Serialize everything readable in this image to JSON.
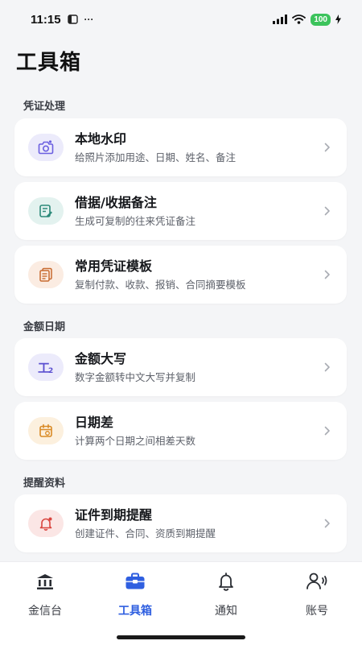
{
  "status_bar": {
    "time": "11:15",
    "extra": "···",
    "battery": "100"
  },
  "page_title": "工具箱",
  "sections": [
    {
      "title": "凭证处理",
      "items": [
        {
          "title": "本地水印",
          "subtitle": "给照片添加用途、日期、姓名、备注",
          "icon": "camera-icon",
          "icon_color": "#6b5fe0",
          "icon_bg": "#ecebfb"
        },
        {
          "title": "借据/收据备注",
          "subtitle": "生成可复制的往来凭证备注",
          "icon": "note-edit-icon",
          "icon_color": "#2d8a7a",
          "icon_bg": "#e3f2ef"
        },
        {
          "title": "常用凭证模板",
          "subtitle": "复制付款、收款、报销、合同摘要模板",
          "icon": "document-stack-icon",
          "icon_color": "#c86a2f",
          "icon_bg": "#fbece2"
        }
      ]
    },
    {
      "title": "金额日期",
      "items": [
        {
          "title": "金额大写",
          "subtitle": "数字金额转中文大写并复制",
          "icon": "amount-uppercase-icon",
          "icon_color": "#5a4fd0",
          "icon_bg": "#ecebfb"
        },
        {
          "title": "日期差",
          "subtitle": "计算两个日期之间相差天数",
          "icon": "calendar-icon",
          "icon_color": "#d98a25",
          "icon_bg": "#fcf0de"
        }
      ]
    },
    {
      "title": "提醒资料",
      "items": [
        {
          "title": "证件到期提醒",
          "subtitle": "创建证件、合同、资质到期提醒",
          "icon": "bell-alert-icon",
          "icon_color": "#d9453f",
          "icon_bg": "#fbe6e5"
        }
      ]
    }
  ],
  "tabs": [
    {
      "label": "金信台",
      "icon": "bank-icon",
      "active": false
    },
    {
      "label": "工具箱",
      "icon": "toolbox-icon",
      "active": true
    },
    {
      "label": "通知",
      "icon": "bell-icon",
      "active": false
    },
    {
      "label": "账号",
      "icon": "account-icon",
      "active": false
    }
  ],
  "colors": {
    "accent": "#2f5fe0",
    "background": "#f4f5f7",
    "battery": "#3cc35c"
  }
}
